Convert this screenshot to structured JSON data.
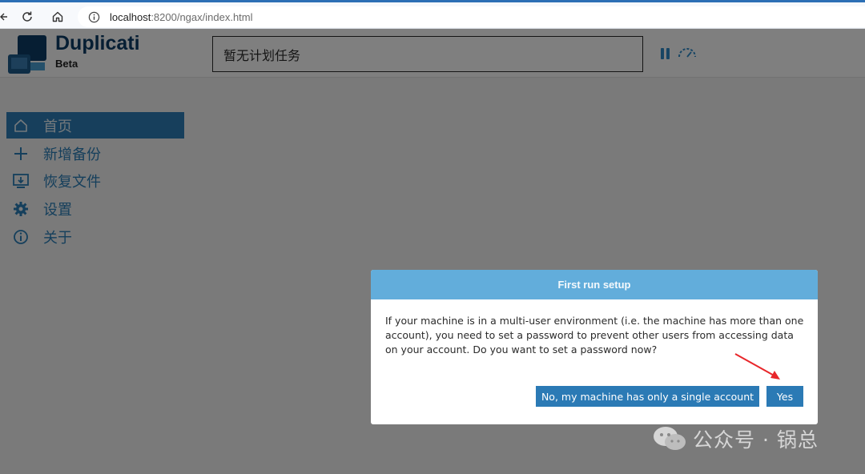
{
  "browser": {
    "url_host": "localhost",
    "url_path": ":8200/ngax/index.html"
  },
  "header": {
    "brand": "Duplicati",
    "brand_sub": "Beta",
    "status": "暂无计划任务"
  },
  "sidebar": {
    "items": [
      {
        "label": "首页",
        "icon": "home-icon",
        "active": true
      },
      {
        "label": "新增备份",
        "icon": "plus-icon",
        "active": false
      },
      {
        "label": "恢复文件",
        "icon": "restore-icon",
        "active": false
      },
      {
        "label": "设置",
        "icon": "gear-icon",
        "active": false
      },
      {
        "label": "关于",
        "icon": "info-icon",
        "active": false
      }
    ]
  },
  "dialog": {
    "title": "First run setup",
    "message": "If your machine is in a multi-user environment (i.e. the machine has more than one account), you need to set a password to prevent other users from accessing data on your account. Do you want to set a password now?",
    "no_label": "No, my machine has only a single account",
    "yes_label": "Yes"
  },
  "watermark": {
    "text": "公众号 · 锅总"
  },
  "colors": {
    "brand": "#0c3c66",
    "accent": "#2f7fb8",
    "dialog_header": "#62addb",
    "button": "#2b7ab5",
    "annotation": "#e8262a"
  }
}
